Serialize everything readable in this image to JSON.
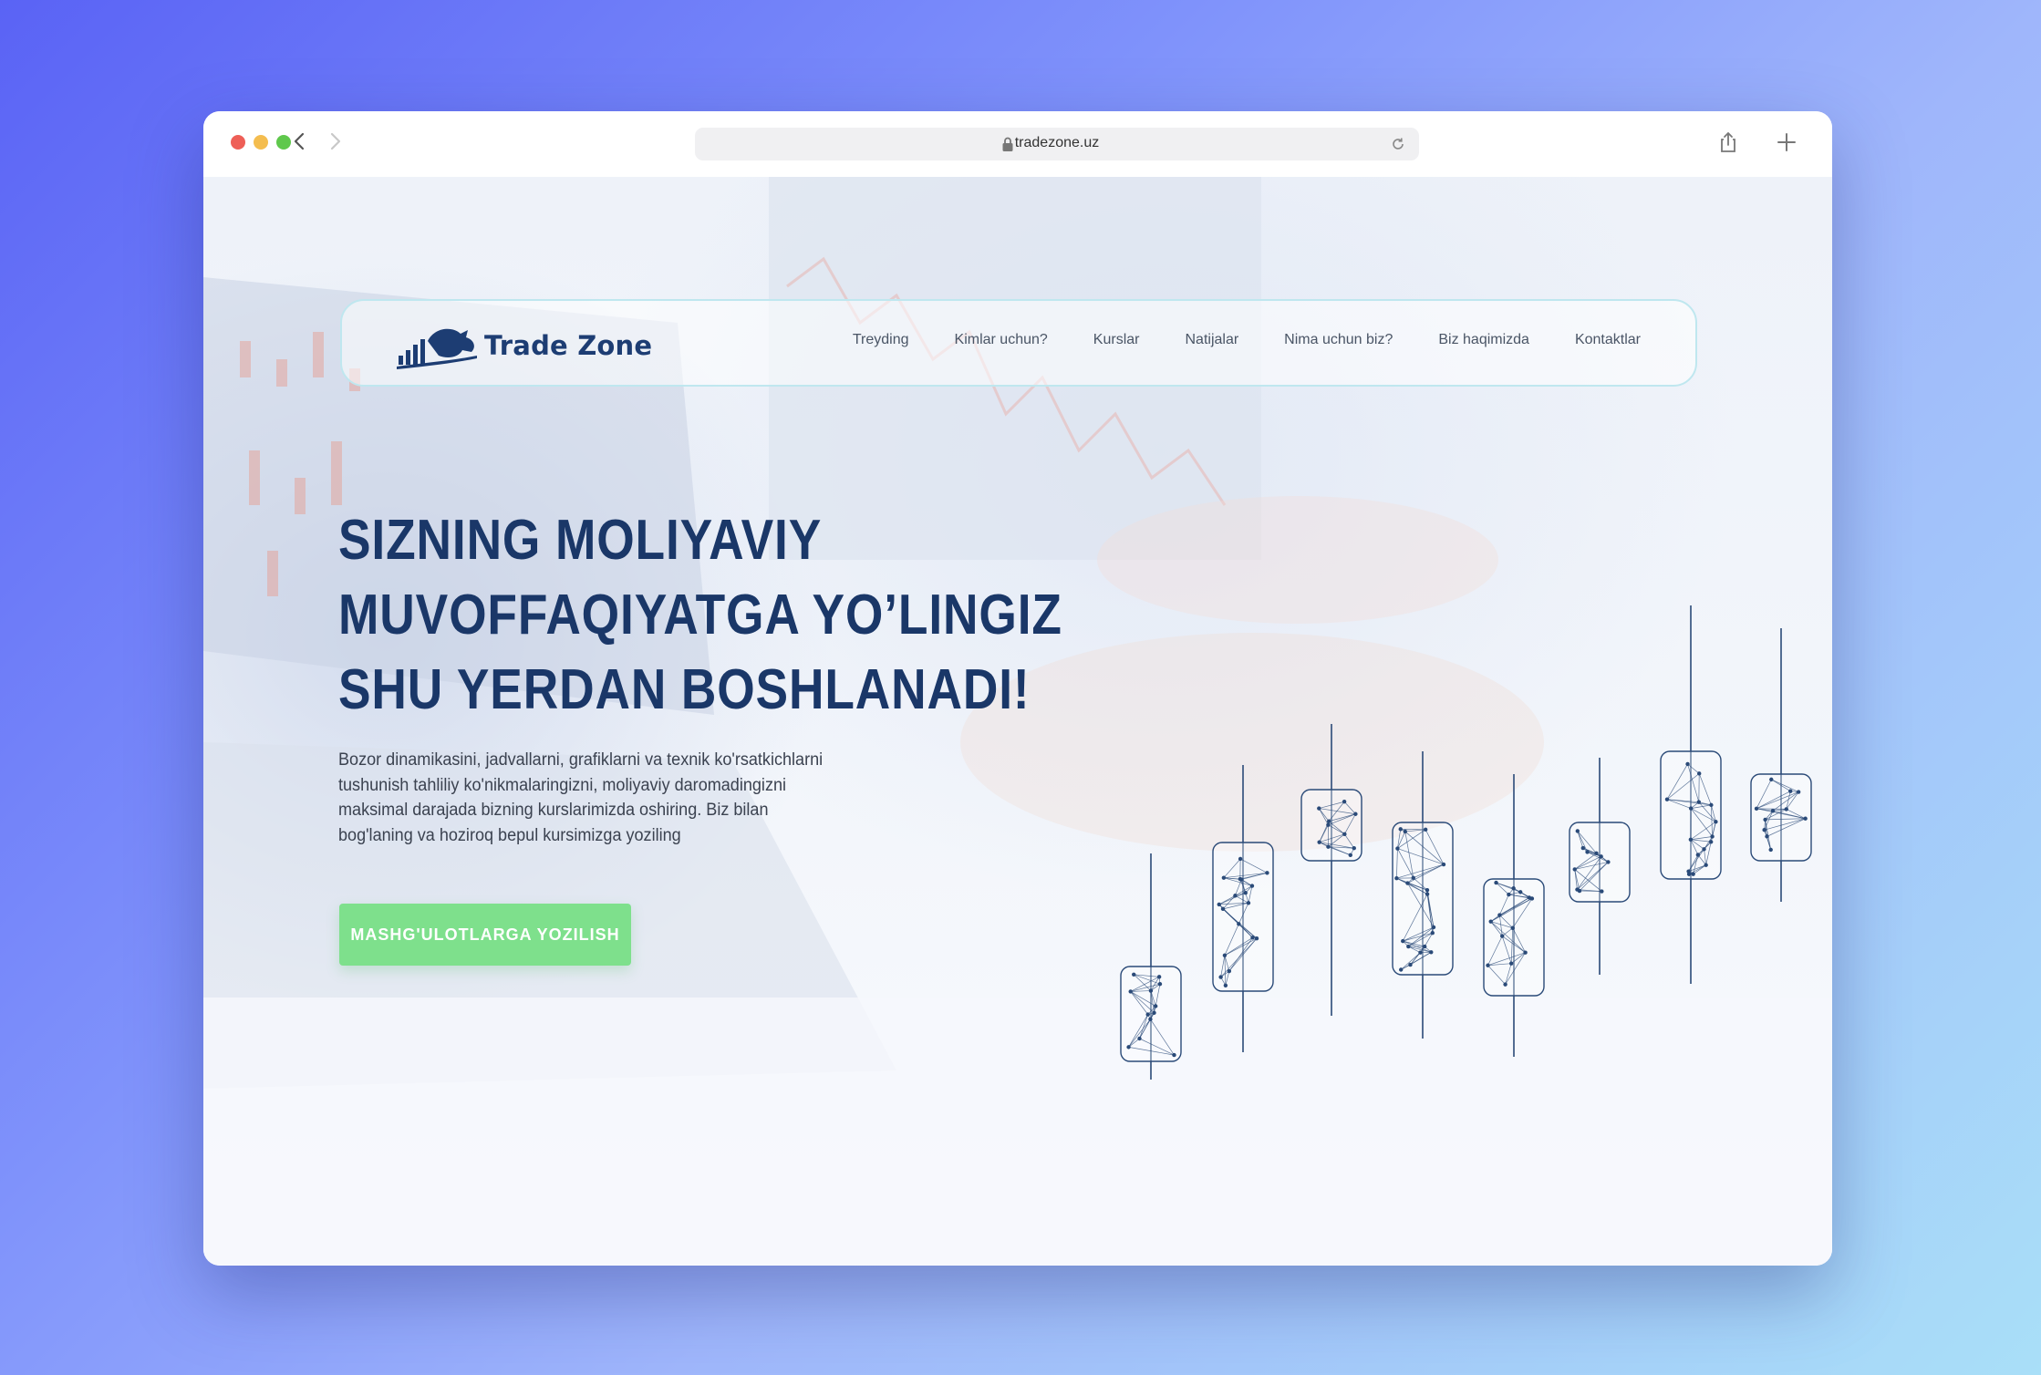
{
  "browser": {
    "url": "tradezone.uz",
    "icons": [
      "close-dot",
      "minimize-dot",
      "zoom-dot",
      "back-arrow",
      "forward-arrow",
      "lock-icon",
      "reload-icon",
      "share-icon",
      "new-tab-icon"
    ]
  },
  "header": {
    "logo_text": "Trade Zone",
    "menu": [
      "Treyding",
      "Kimlar uchun?",
      "Kurslar",
      "Natijalar",
      "Nima uchun biz?",
      "Biz haqimizda",
      "Kontaktlar"
    ]
  },
  "hero": {
    "title_lines": [
      "SIZNING MOLIYAVIY",
      "MUVOFFAQIYATGA YO’LINGIZ",
      "SHU YERDAN BOSHLANADI!"
    ],
    "text_lines": [
      "Bozor dinamikasini, jadvallarni, grafiklarni va texnik ko'rsatkichlarni",
      "tushunish tahliliy ko'nikmalaringizni, moliyaviy daromadingizni",
      "maksimal darajada bizning kurslarimizda oshiring. Biz bilan",
      "bog'laning va hoziroq bepul kursimizga yoziling"
    ],
    "cta_label": "MASHG'ULOTLARGA YOZILISH"
  },
  "colors": {
    "title": "#1a3768",
    "cta": "#7ee08c",
    "header_border": "#bfe7ef",
    "candle_stroke": "#2a4a78"
  }
}
